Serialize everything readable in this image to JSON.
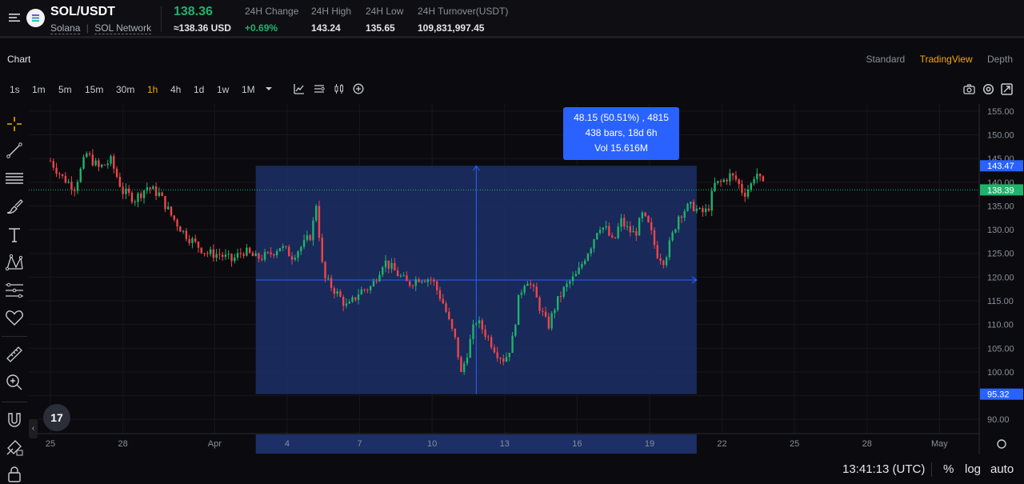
{
  "header": {
    "pair": "SOL/USDT",
    "name": "Solana",
    "separator": "|",
    "network": "SOL Network",
    "last_price": "138.36",
    "last_price_usd": "≈138.36 USD",
    "stats": [
      {
        "label": "24H Change",
        "value": "+0.69%",
        "color": "green"
      },
      {
        "label": "24H High",
        "value": "143.24"
      },
      {
        "label": "24H Low",
        "value": "135.65"
      },
      {
        "label": "24H Turnover(USDT)",
        "value": "109,831,997.45"
      }
    ]
  },
  "chart_header": {
    "title": "Chart",
    "views": [
      "Standard",
      "TradingView",
      "Depth"
    ],
    "active_view": "TradingView"
  },
  "timeframes": [
    "1s",
    "1m",
    "5m",
    "15m",
    "30m",
    "1h",
    "4h",
    "1d",
    "1w",
    "1M"
  ],
  "active_timeframe": "1h",
  "toolbar_icons": [
    "chevron-down-icon",
    "indicator-icon",
    "chart-type-icon",
    "candles-icon",
    "add-icon"
  ],
  "right_icons": [
    "camera-icon",
    "settings-icon",
    "fullscreen-icon"
  ],
  "left_tools": [
    "crosshair-icon",
    "trend-line-icon",
    "horizontal-lines-icon",
    "brush-icon",
    "text-icon",
    "pattern-icon",
    "projection-icon",
    "favorites-heart-icon",
    "ruler-icon",
    "zoom-in-icon",
    "magnet-icon",
    "lock-drawing-icon",
    "lock-icon"
  ],
  "measure_tooltip": {
    "line1": "48.15 (50.51%) , 4815",
    "line2": "438 bars, 18d 6h",
    "line3": "Vol 15.616M"
  },
  "logo_text": "17",
  "bottom": {
    "clock": "13:41:13 (UTC)",
    "percent": "%",
    "log": "log",
    "auto": "auto"
  },
  "colors": {
    "up": "#20b26c",
    "down": "#ef454a",
    "accent": "#f7a600",
    "measure_fill": "#1c2f66",
    "measure_line": "#2962ff"
  },
  "chart_data": {
    "type": "candlestick",
    "x_ticks": [
      "25",
      "28",
      "Apr",
      "4",
      "7",
      "10",
      "13",
      "16",
      "19",
      "22",
      "25",
      "28",
      "May"
    ],
    "y_ticks": [
      "155.00",
      "150.00",
      "145.00",
      "140.00",
      "135.00",
      "130.00",
      "125.00",
      "120.00",
      "115.00",
      "110.00",
      "105.00",
      "100.00",
      "95.00",
      "90.00"
    ],
    "ylim": [
      87,
      156.5
    ],
    "price_labels": [
      {
        "value": 143.47,
        "text": "143.47",
        "kind": "measure"
      },
      {
        "value": 138.39,
        "text": "138.39",
        "kind": "last"
      },
      {
        "value": 95.32,
        "text": "95.32",
        "kind": "measure"
      }
    ],
    "measure": {
      "from_price": 95.32,
      "to_price": 143.47,
      "start_day": 8.5,
      "end_day": 26.75
    },
    "x_start_day": 24.7,
    "x_end_day": 33.5,
    "series": [
      [
        0,
        144.5
      ],
      [
        0.5,
        141
      ],
      [
        1,
        139
      ],
      [
        1.5,
        146
      ],
      [
        2,
        143
      ],
      [
        2.5,
        144.5
      ],
      [
        3,
        138
      ],
      [
        3.5,
        136.5
      ],
      [
        4,
        139
      ],
      [
        4.5,
        137.5
      ],
      [
        5,
        133
      ],
      [
        5.5,
        129.5
      ],
      [
        6,
        127
      ],
      [
        6.5,
        125
      ],
      [
        7,
        124.8
      ],
      [
        7.5,
        123.5
      ],
      [
        8,
        125.5
      ],
      [
        8.5,
        124
      ],
      [
        9,
        124.5
      ],
      [
        9.5,
        126.5
      ],
      [
        10,
        124.5
      ],
      [
        10.5,
        127
      ],
      [
        10.8,
        129
      ],
      [
        11,
        135.5
      ],
      [
        11.3,
        120
      ],
      [
        11.8,
        117
      ],
      [
        12.3,
        113.5
      ],
      [
        12.8,
        117
      ],
      [
        13.3,
        118
      ],
      [
        13.8,
        123.5
      ],
      [
        14.3,
        121
      ],
      [
        14.8,
        118.5
      ],
      [
        15.3,
        120
      ],
      [
        15.8,
        119.5
      ],
      [
        16.3,
        114
      ],
      [
        16.5,
        110.5
      ],
      [
        16.8,
        106
      ],
      [
        17,
        99.5
      ],
      [
        17.3,
        105
      ],
      [
        17.6,
        111
      ],
      [
        17.9,
        109
      ],
      [
        18.2,
        106.5
      ],
      [
        18.5,
        104
      ],
      [
        18.8,
        102.5
      ],
      [
        19.1,
        106
      ],
      [
        19.4,
        116
      ],
      [
        19.7,
        120
      ],
      [
        20,
        117
      ],
      [
        20.3,
        113
      ],
      [
        20.6,
        109.5
      ],
      [
        20.9,
        114
      ],
      [
        21.2,
        117
      ],
      [
        21.5,
        119
      ],
      [
        21.8,
        120.5
      ],
      [
        22.1,
        124
      ],
      [
        22.4,
        127
      ],
      [
        22.7,
        131
      ],
      [
        23,
        130
      ],
      [
        23.3,
        127
      ],
      [
        23.6,
        132
      ],
      [
        23.9,
        130
      ],
      [
        24.2,
        129
      ],
      [
        24.5,
        133
      ],
      [
        24.8,
        130.5
      ],
      [
        25.1,
        125
      ],
      [
        25.4,
        123.5
      ],
      [
        25.7,
        128
      ],
      [
        26,
        133
      ],
      [
        26.3,
        134.5
      ],
      [
        26.6,
        135
      ],
      [
        26.9,
        133.5
      ],
      [
        27.2,
        134
      ],
      [
        27.5,
        139.5
      ],
      [
        27.8,
        140
      ],
      [
        28.1,
        141.5
      ],
      [
        28.4,
        140.5
      ],
      [
        28.7,
        137.5
      ],
      [
        29,
        139.5
      ],
      [
        29.2,
        142.5
      ],
      [
        29.4,
        140
      ],
      [
        29.6,
        138.4
      ]
    ]
  }
}
